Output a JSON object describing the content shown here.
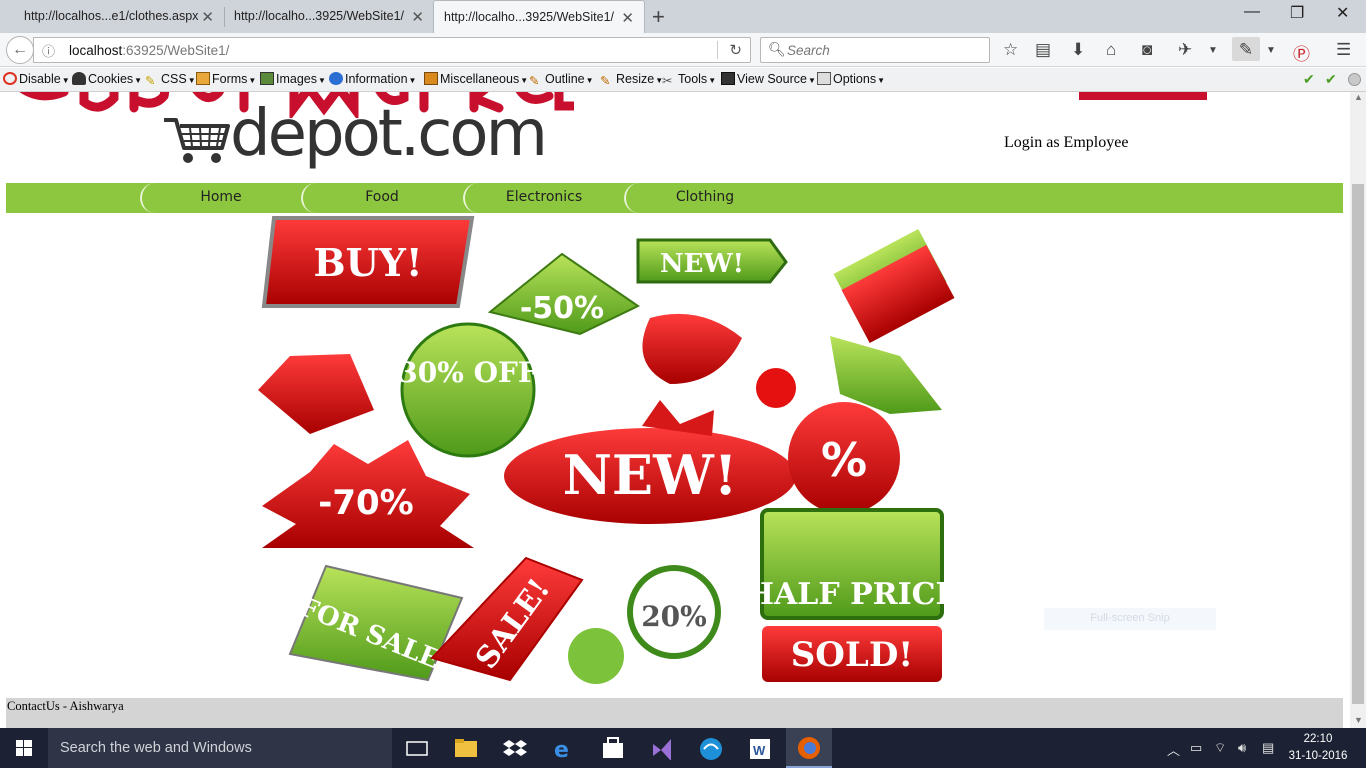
{
  "browser": {
    "tabs": [
      {
        "title": "http://localhos...e1/clothes.aspx"
      },
      {
        "title": "http://localho...3925/WebSite1/"
      },
      {
        "title": "http://localho...3925/WebSite1/"
      }
    ],
    "url_host": "localhost",
    "url_rest": ":63925/WebSite1/",
    "search_placeholder": "Search"
  },
  "devbar": {
    "items": [
      "Disable",
      "Cookies",
      "CSS",
      "Forms",
      "Images",
      "Information",
      "Miscellaneous",
      "Outline",
      "Resize",
      "Tools",
      "View Source",
      "Options"
    ]
  },
  "site": {
    "login_link": "Login as Employee",
    "menu": [
      "Home",
      "Food",
      "Electronics",
      "Clothing"
    ],
    "footer": "ContactUs - Aishwarya",
    "snip_label": "Full-screen Snip",
    "banner_tags": [
      "BUY!",
      "NEW!",
      "-50%",
      "30% OFF",
      "NEW!",
      "%",
      "-70%",
      "HALF PRICE",
      "FOR SALE!",
      "SALE!",
      "20%",
      "SOLD!"
    ]
  },
  "taskbar": {
    "search_placeholder": "Search the web and Windows",
    "time": "22:10",
    "date": "31-10-2016"
  },
  "colors": {
    "brand_red": "#c8102e",
    "menu_green": "#8dc63f",
    "footer_gray": "#d4d4d4"
  }
}
